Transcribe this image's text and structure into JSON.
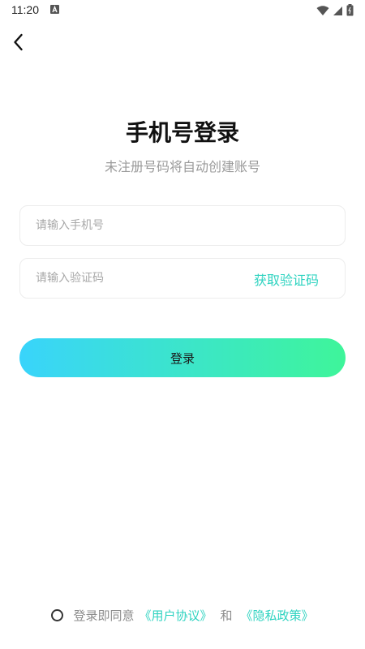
{
  "status_bar": {
    "time": "11:20"
  },
  "header": {
    "title": "手机号登录",
    "subtitle": "未注册号码将自动创建账号"
  },
  "form": {
    "phone_placeholder": "请输入手机号",
    "code_placeholder": "请输入验证码",
    "get_code_label": "获取验证码"
  },
  "login_button_label": "登录",
  "agreement": {
    "prefix": "登录即同意",
    "user_agreement": "《用户协议》",
    "conjunction": "和",
    "privacy_policy": "《隐私政策》"
  },
  "colors": {
    "accent": "#2ed3c0",
    "gradient_start": "#39d4fb",
    "gradient_end": "#3ef59a"
  }
}
